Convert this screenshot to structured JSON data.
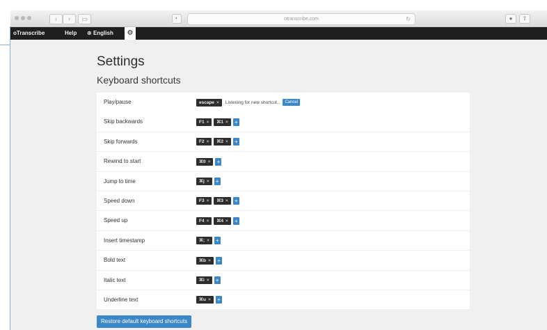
{
  "browser": {
    "url": "otranscribe.com",
    "reload_icon": "reload-icon",
    "back_icon": "chevron-left-icon",
    "forward_icon": "chevron-right-icon"
  },
  "nav": {
    "brand": "oTranscribe",
    "help": "Help",
    "language": "English",
    "settings_icon": "gear-icon"
  },
  "page": {
    "title": "Settings",
    "section": "Keyboard shortcuts"
  },
  "shortcuts": [
    {
      "label": "Play/pause",
      "keys": [
        "escape"
      ],
      "listening": true
    },
    {
      "label": "Skip backwards",
      "keys": [
        "F1",
        "⌘1"
      ]
    },
    {
      "label": "Skip forwards",
      "keys": [
        "F2",
        "⌘2"
      ]
    },
    {
      "label": "Rewind to start",
      "keys": [
        "⌘0"
      ]
    },
    {
      "label": "Jump to time",
      "keys": [
        "⌘j"
      ]
    },
    {
      "label": "Speed down",
      "keys": [
        "F3",
        "⌘3"
      ]
    },
    {
      "label": "Speed up",
      "keys": [
        "F4",
        "⌘4"
      ]
    },
    {
      "label": "Insert timestamp",
      "keys": [
        "⌘;"
      ]
    },
    {
      "label": "Bold text",
      "keys": [
        "⌘b"
      ]
    },
    {
      "label": "Italic text",
      "keys": [
        "⌘i"
      ]
    },
    {
      "label": "Underline text",
      "keys": [
        "⌘u"
      ]
    }
  ],
  "listening_text": "Listening for new shortcut...",
  "cancel_label": "Cancel",
  "add_label": "+",
  "remove_label": "×",
  "restore_label": "Restore default keyboard shortcuts",
  "colors": {
    "accent": "#3c87c5",
    "navbar": "#1f1f1f",
    "key_bg": "#2d2d2d",
    "page_bg": "#f0f0f0"
  }
}
